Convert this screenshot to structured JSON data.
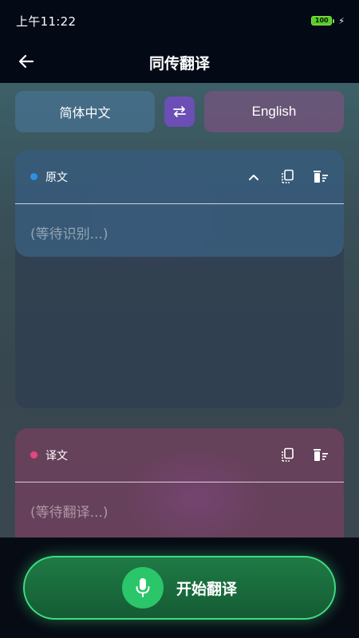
{
  "status_bar": {
    "time": "上午11:22",
    "battery_level": "100"
  },
  "app_bar": {
    "title": "同传翻译",
    "back_icon": "arrow-left-icon"
  },
  "languages": {
    "source": "简体中文",
    "target": "English",
    "swap_icon": "swap-arrows-icon"
  },
  "source_panel": {
    "label": "原文",
    "placeholder": "(等待识别...)",
    "dot_color": "#2f8fe0",
    "icons": [
      "chevron-up-icon",
      "copy-icon",
      "clear-icon"
    ]
  },
  "target_panel": {
    "label": "译文",
    "placeholder": "(等待翻译...)",
    "dot_color": "#e8457e",
    "icons": [
      "copy-icon",
      "clear-icon"
    ]
  },
  "start_button": {
    "label": "开始翻译",
    "icon": "microphone-icon",
    "accent": "#2bc56a"
  }
}
